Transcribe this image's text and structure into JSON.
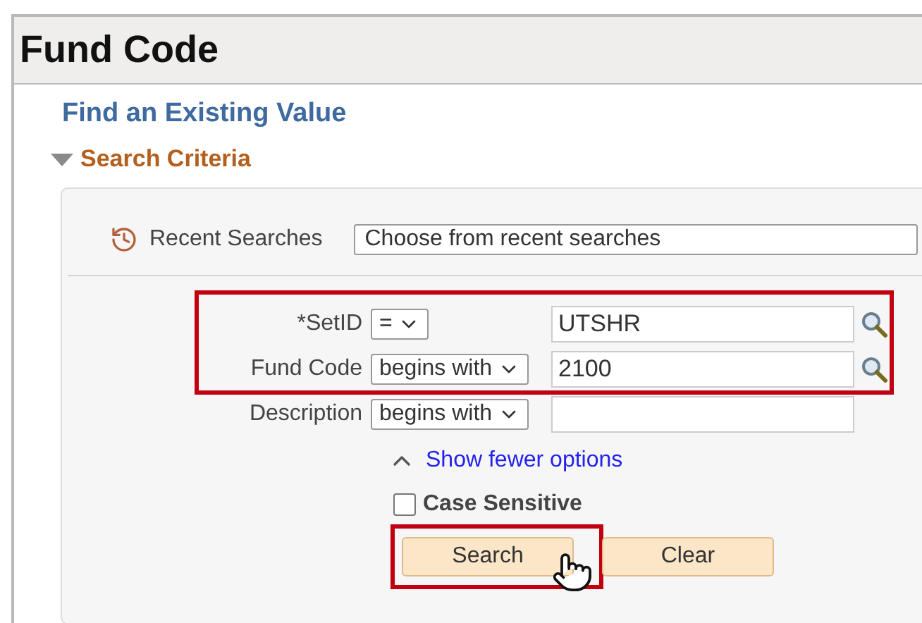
{
  "page_title": "Fund Code",
  "heading": "Find an Existing Value",
  "section": {
    "title": "Search Criteria",
    "expanded": true
  },
  "recent_searches": {
    "label": "Recent Searches",
    "value": "Choose from recent searches"
  },
  "criteria": [
    {
      "label": "*SetID",
      "operator": "=",
      "value": "UTSHR",
      "lookup": true,
      "highlighted": true
    },
    {
      "label": "Fund Code",
      "operator": "begins with",
      "value": "2100",
      "lookup": true,
      "highlighted": true
    },
    {
      "label": "Description",
      "operator": "begins with",
      "lookup": false,
      "highlighted": false
    }
  ],
  "options_link": "Show fewer options",
  "case_sensitive": {
    "label": "Case Sensitive",
    "checked": false
  },
  "buttons": [
    {
      "label": "Search",
      "highlighted": true
    },
    {
      "label": "Clear",
      "highlighted": false
    }
  ]
}
